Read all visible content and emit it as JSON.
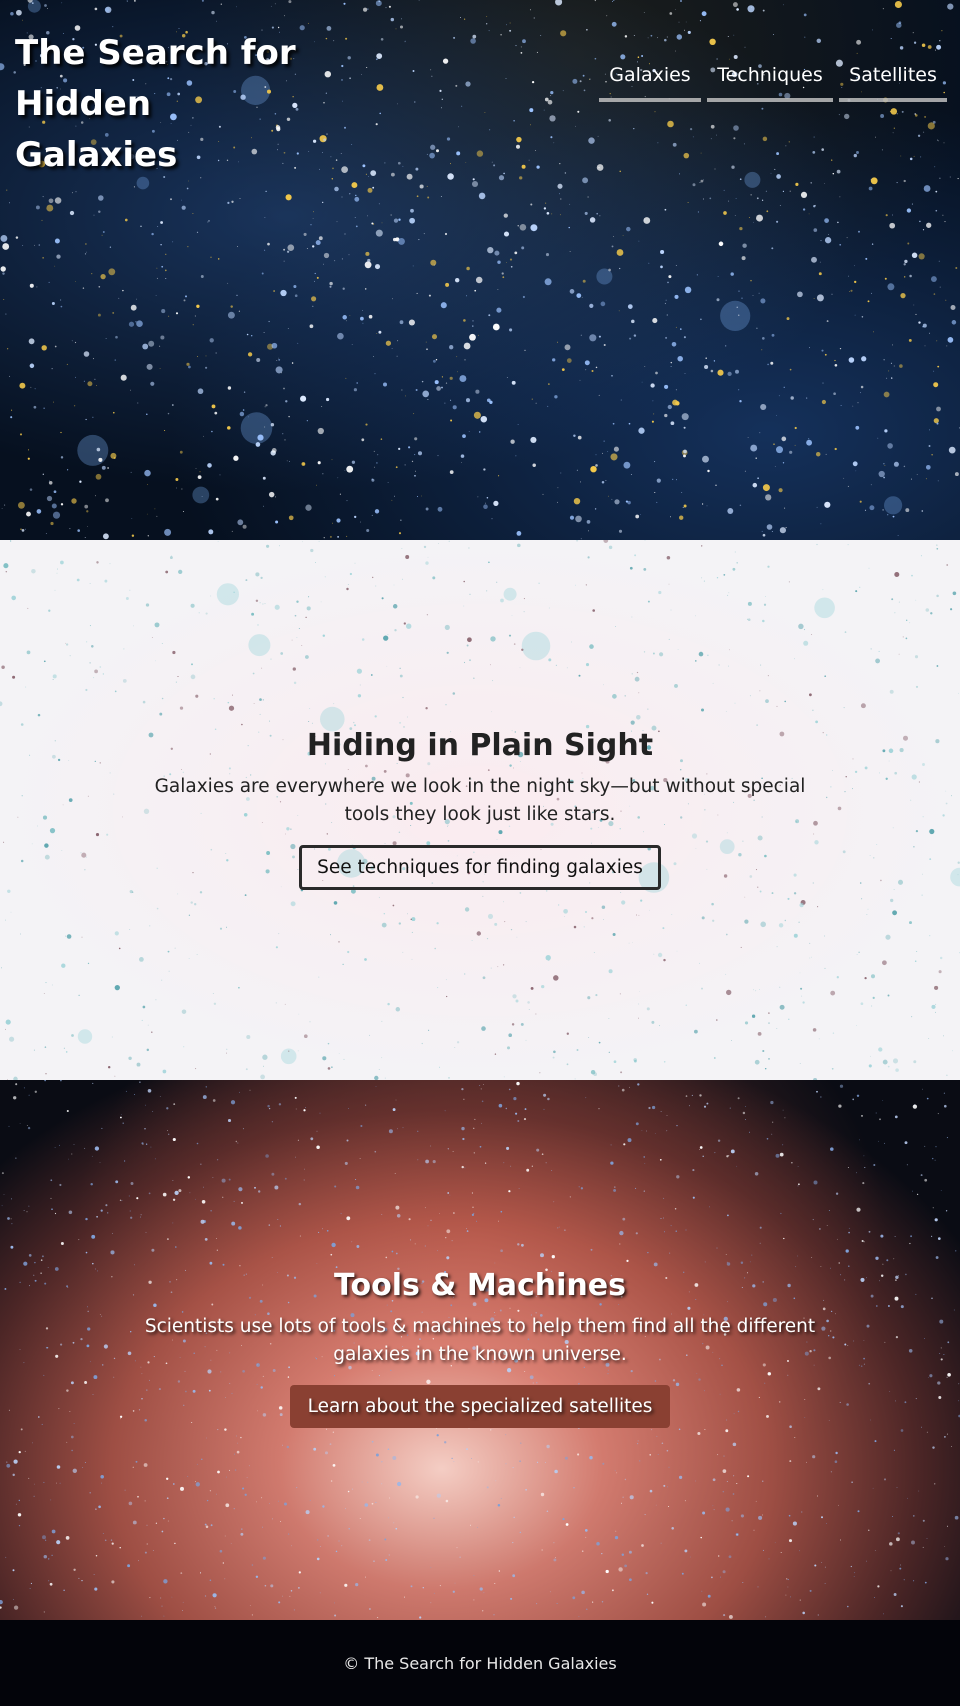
{
  "header": {
    "site_title": "The Search for Hidden Galaxies",
    "nav": [
      {
        "label": "Galaxies"
      },
      {
        "label": "Techniques"
      },
      {
        "label": "Satellites"
      }
    ]
  },
  "hiding_section": {
    "title": "Hiding in Plain Sight",
    "text": "Galaxies are everywhere we look in the night sky—but without special tools they look just like stars.",
    "button_label": "See techniques for finding galaxies"
  },
  "tools_section": {
    "title": "Tools & Machines",
    "text": "Scientists use lots of tools & machines to help them find all the different galaxies in the known universe.",
    "button_label": "Learn about the specialized satellites"
  },
  "footer": {
    "copyright": "© The Search for Hidden Galaxies"
  },
  "colors": {
    "hero_bg": "#06101f",
    "section2_bg": "#f4f3f6",
    "nebula_button": "#8a4032",
    "footer_bg": "#03040a"
  }
}
